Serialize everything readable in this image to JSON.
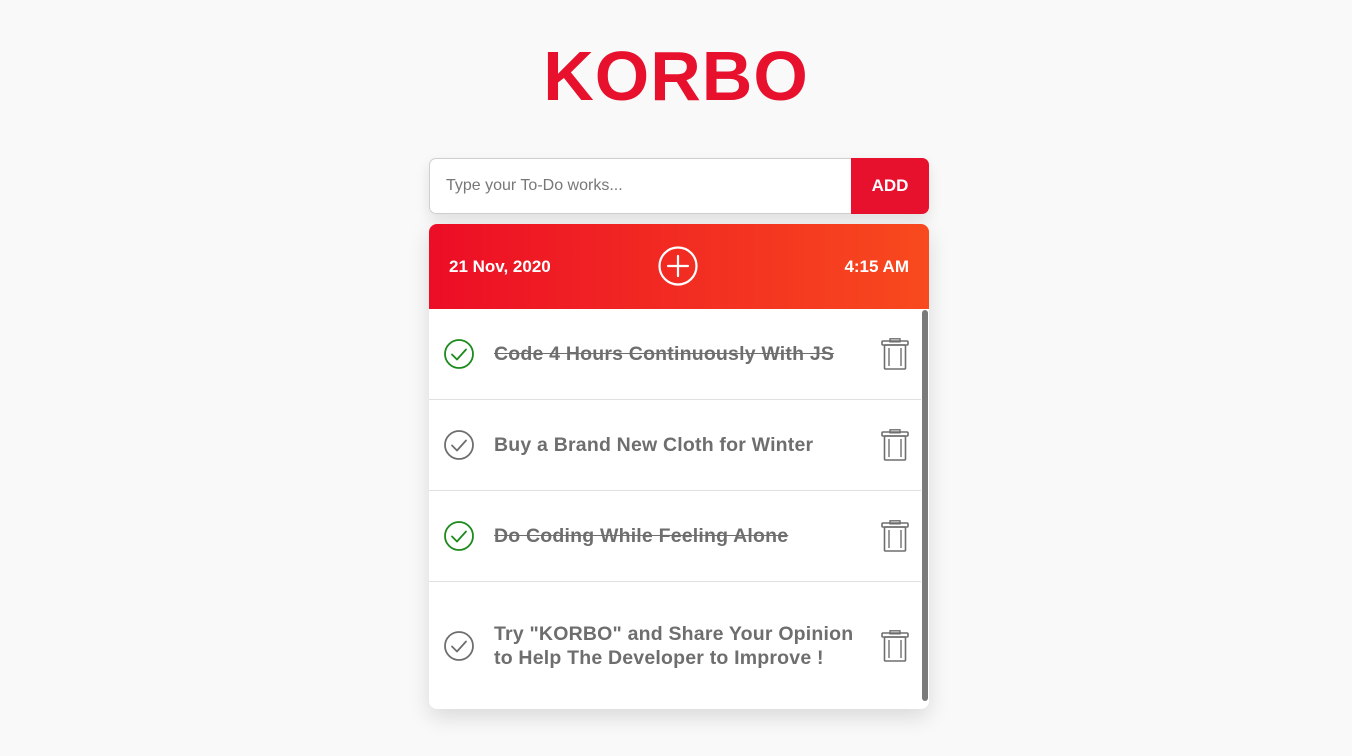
{
  "app": {
    "title": "KORBO"
  },
  "colors": {
    "brand_red": "#e8112d",
    "header_gradient_start": "#ec0d26",
    "header_gradient_end": "#f84a1e",
    "done_check": "#1a8a1a",
    "pending_check": "#6e6e6e",
    "text_gray": "#6e6e6e"
  },
  "input": {
    "placeholder": "Type your To-Do works...",
    "value": ""
  },
  "add_button": {
    "label": "ADD"
  },
  "header": {
    "date": "21 Nov, 2020",
    "time": "4:15 AM",
    "plus_icon": "plus-circle-icon"
  },
  "todos": [
    {
      "text": "Code 4 Hours Continuously With JS",
      "done": true
    },
    {
      "text": "Buy a Brand New Cloth for Winter",
      "done": false
    },
    {
      "text": "Do Coding While Feeling Alone",
      "done": true
    },
    {
      "text": "Try \"KORBO\" and Share Your Opinion to Help The Developer to Improve !",
      "done": false
    }
  ]
}
